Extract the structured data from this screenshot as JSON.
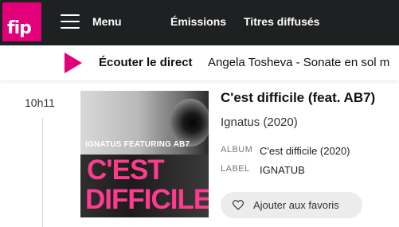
{
  "header": {
    "logo_text": "fip",
    "menu_label": "Menu",
    "nav": [
      "Émissions",
      "Titres diffusés"
    ]
  },
  "live": {
    "label": "Écouter le direct",
    "track": "Angela Tosheva - Sonate en sol m"
  },
  "track": {
    "time": "10h11",
    "title": "C'est difficile (feat. AB7)",
    "artist_year": "Ignatus (2020)",
    "album_key": "ALBUM",
    "album_value": "C'est difficile (2020)",
    "label_key": "LABEL",
    "label_value": "IGNATUB",
    "favorite_label": "Ajouter aux favoris",
    "cover": {
      "artist_line": "IGNATUS FEATURING AB7",
      "title_line1": "C'EST",
      "title_line2": "DIFFICILE"
    }
  },
  "colors": {
    "brand": "#e2007a",
    "topbar": "#1f2021"
  },
  "icons": [
    "menu-icon",
    "play-icon",
    "heart-icon"
  ]
}
